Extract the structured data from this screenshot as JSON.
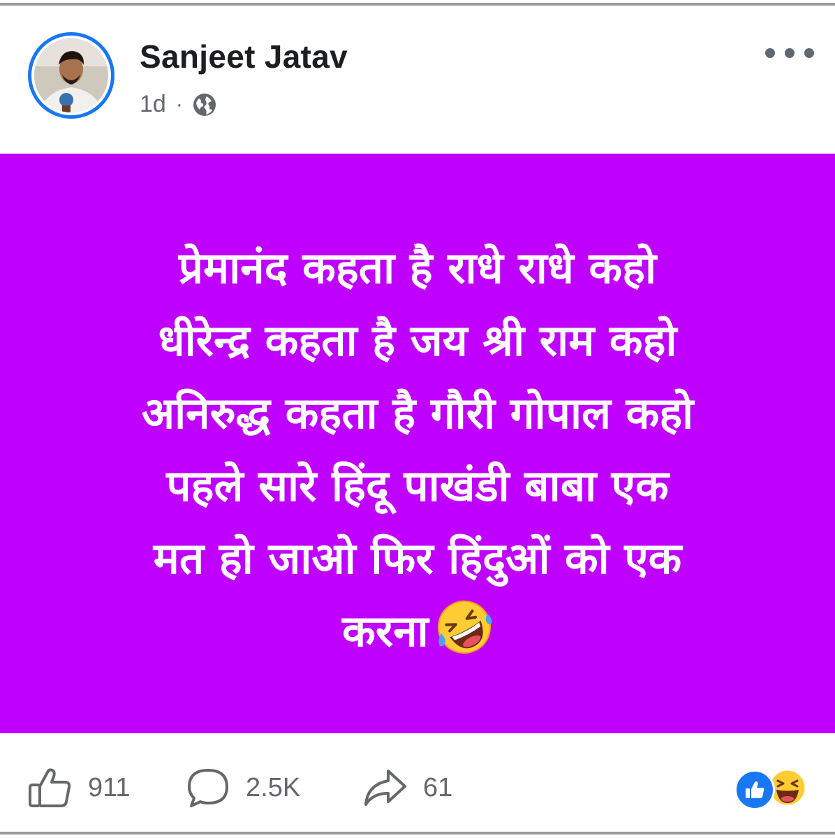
{
  "post": {
    "author": "Sanjeet Jatav",
    "time": "1d",
    "separator": "·",
    "privacy_icon": "globe-icon",
    "more_icon": "more-dots-icon",
    "background_color": "#bf00ff",
    "text_color": "#ffffff",
    "text_lines": [
      "प्रेमानंद कहता है राधे राधे कहो",
      "धीरेन्द्र कहता है जय श्री राम कहो",
      "अनिरुद्ध कहता है गौरी गोपाल कहो",
      "पहले सारे हिंदू पाखंडी बाबा एक",
      "मत हो जाओ फिर हिंदुओं को एक",
      "करना"
    ],
    "trailing_emoji": "rolling-on-floor-laughing-emoji"
  },
  "footer": {
    "likes": "911",
    "comments": "2.5K",
    "shares": "61",
    "reactions": [
      "like-reaction-icon",
      "haha-reaction-icon"
    ],
    "accent_color": "#1877f2"
  }
}
